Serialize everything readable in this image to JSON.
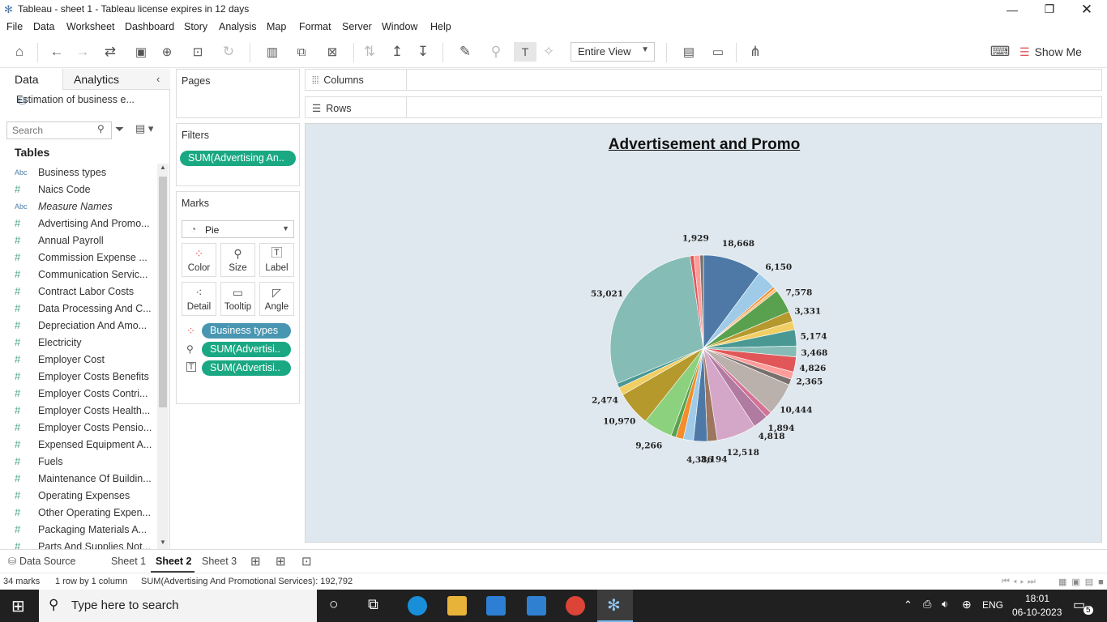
{
  "window": {
    "title": "Tableau - sheet 1 - Tableau license expires in 12 days"
  },
  "menu": [
    "File",
    "Data",
    "Worksheet",
    "Dashboard",
    "Story",
    "Analysis",
    "Map",
    "Format",
    "Server",
    "Window",
    "Help"
  ],
  "toolbar": {
    "view_mode": "Entire View",
    "show_me": "Show Me"
  },
  "left_pane": {
    "tabs": [
      "Data",
      "Analytics"
    ],
    "datasource": "Estimation of business e...",
    "search_placeholder": "Search",
    "tables_heading": "Tables",
    "fields": [
      {
        "type": "Abc",
        "name": "Business types"
      },
      {
        "type": "#",
        "name": "Naics Code"
      },
      {
        "type": "Abc",
        "name": "Measure Names"
      },
      {
        "type": "#",
        "name": "Advertising And Promo..."
      },
      {
        "type": "#",
        "name": "Annual Payroll"
      },
      {
        "type": "#",
        "name": "Commission Expense ..."
      },
      {
        "type": "#",
        "name": "Communication Servic..."
      },
      {
        "type": "#",
        "name": "Contract Labor Costs"
      },
      {
        "type": "#",
        "name": "Data Processing And C..."
      },
      {
        "type": "#",
        "name": "Depreciation And Amo..."
      },
      {
        "type": "#",
        "name": "Electricity"
      },
      {
        "type": "#",
        "name": "Employer Cost"
      },
      {
        "type": "#",
        "name": "Employer Costs Benefits"
      },
      {
        "type": "#",
        "name": "Employer Costs Contri..."
      },
      {
        "type": "#",
        "name": "Employer Costs Health..."
      },
      {
        "type": "#",
        "name": "Employer Costs Pensio..."
      },
      {
        "type": "#",
        "name": "Expensed Equipment A..."
      },
      {
        "type": "#",
        "name": "Fuels"
      },
      {
        "type": "#",
        "name": "Maintenance Of Buildin..."
      },
      {
        "type": "#",
        "name": "Operating Expenses"
      },
      {
        "type": "#",
        "name": "Other Operating Expen..."
      },
      {
        "type": "#",
        "name": "Packaging Materials A..."
      },
      {
        "type": "#",
        "name": "Parts And Supplies Not..."
      }
    ]
  },
  "shelves": {
    "pages": "Pages",
    "filters": "Filters",
    "filter_pill": "SUM(Advertising An..",
    "marks": "Marks",
    "mark_type": "Pie",
    "mark_buttons": [
      "Color",
      "Size",
      "Label",
      "Detail",
      "Tooltip",
      "Angle"
    ],
    "mark_pills": [
      "Business types",
      "SUM(Advertisi..",
      "SUM(Advertisi.."
    ],
    "columns": "Columns",
    "rows": "Rows"
  },
  "chart_data": {
    "type": "pie",
    "title": "Advertisement and Promo",
    "labeled_values": [
      18668,
      6150,
      7578,
      3331,
      5174,
      3468,
      4826,
      2365,
      10444,
      1894,
      4818,
      12518,
      3194,
      4386,
      9266,
      10970,
      2474,
      53021,
      1929
    ],
    "slices": [
      {
        "value": 18668,
        "color": "#4e79a7",
        "label": "18,668"
      },
      {
        "value": 6150,
        "color": "#a0cbe8",
        "label": "6,150"
      },
      {
        "value": 800,
        "color": "#f28e2b",
        "label": ""
      },
      {
        "value": 900,
        "color": "#ffbe7d",
        "label": ""
      },
      {
        "value": 7578,
        "color": "#59a14f",
        "label": "7,578"
      },
      {
        "value": 3331,
        "color": "#b6992d",
        "label": "3,331"
      },
      {
        "value": 2600,
        "color": "#f1ce63",
        "label": ""
      },
      {
        "value": 5174,
        "color": "#499894",
        "label": "5,174"
      },
      {
        "value": 3468,
        "color": "#86bcb6",
        "label": "3,468"
      },
      {
        "value": 4826,
        "color": "#e15759",
        "label": "4,826"
      },
      {
        "value": 2365,
        "color": "#ff9d9a",
        "label": "2,365"
      },
      {
        "value": 1900,
        "color": "#79706e",
        "label": ""
      },
      {
        "value": 10444,
        "color": "#bab0ac",
        "label": "10,444"
      },
      {
        "value": 1894,
        "color": "#d37295",
        "label": "1,894"
      },
      {
        "value": 4818,
        "color": "#b07aa1",
        "label": "4,818"
      },
      {
        "value": 12518,
        "color": "#d4a6c8",
        "label": "12,518"
      },
      {
        "value": 3194,
        "color": "#9d7660",
        "label": "3,194"
      },
      {
        "value": 4386,
        "color": "#4e79a7",
        "label": "4,386"
      },
      {
        "value": 3200,
        "color": "#a0cbe8",
        "label": ""
      },
      {
        "value": 2400,
        "color": "#f28e2b",
        "label": ""
      },
      {
        "value": 1600,
        "color": "#59a14f",
        "label": ""
      },
      {
        "value": 9266,
        "color": "#8cd17d",
        "label": "9,266"
      },
      {
        "value": 10970,
        "color": "#b6992d",
        "label": "10,970"
      },
      {
        "value": 2474,
        "color": "#f1ce63",
        "label": "2,474"
      },
      {
        "value": 1500,
        "color": "#499894",
        "label": ""
      },
      {
        "value": 53021,
        "color": "#86bcb6",
        "label": "53,021"
      },
      {
        "value": 1200,
        "color": "#e15759",
        "label": ""
      },
      {
        "value": 1929,
        "color": "#ff9d9a",
        "label": "1,929"
      },
      {
        "value": 1100,
        "color": "#79706e",
        "label": ""
      }
    ]
  },
  "sheet_tabs": [
    "Data Source",
    "Sheet 1",
    "Sheet 2",
    "Sheet 3"
  ],
  "active_sheet": "Sheet 2",
  "status": {
    "marks": "34 marks",
    "dims": "1 row by 1 column",
    "sum": "SUM(Advertising And Promotional Services): 192,792"
  },
  "taskbar": {
    "search": "Type here to search",
    "lang": "ENG",
    "time": "18:01",
    "date": "06-10-2023",
    "notif": "5"
  }
}
